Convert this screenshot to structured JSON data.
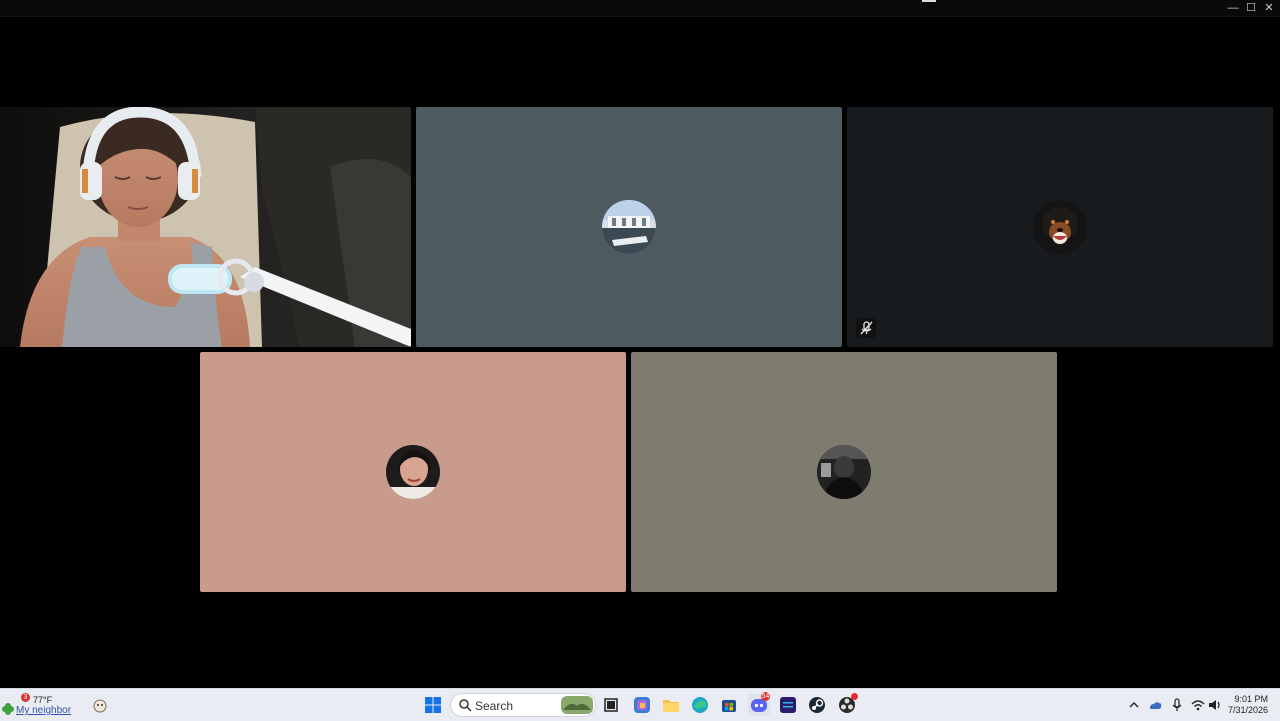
{
  "window": {
    "controls": {
      "minimize": "—",
      "maximize": "☐",
      "close": "✕"
    }
  },
  "call": {
    "participants": [
      {
        "type": "camera",
        "muted": false
      },
      {
        "type": "avatar",
        "tile_color": "#4d5a60",
        "muted": false
      },
      {
        "type": "avatar",
        "tile_color": "#181b1e",
        "muted": true
      },
      {
        "type": "avatar",
        "tile_color": "#c99b8c",
        "muted": false
      },
      {
        "type": "avatar",
        "tile_color": "#7e7c6f",
        "muted": false
      }
    ]
  },
  "taskbar": {
    "weather": {
      "alert_count": "3",
      "temperature": "77°F",
      "description": "My neighbor"
    },
    "search": {
      "placeholder": "Search"
    },
    "apps": [
      "start",
      "search",
      "task-view",
      "copilot",
      "file-explorer",
      "edge",
      "store",
      "discord",
      "amazon-music",
      "steam",
      "obs"
    ],
    "badges": {
      "discord": "54"
    },
    "clock": {
      "time": "9:01 PM",
      "date": "7/31/2026"
    }
  }
}
